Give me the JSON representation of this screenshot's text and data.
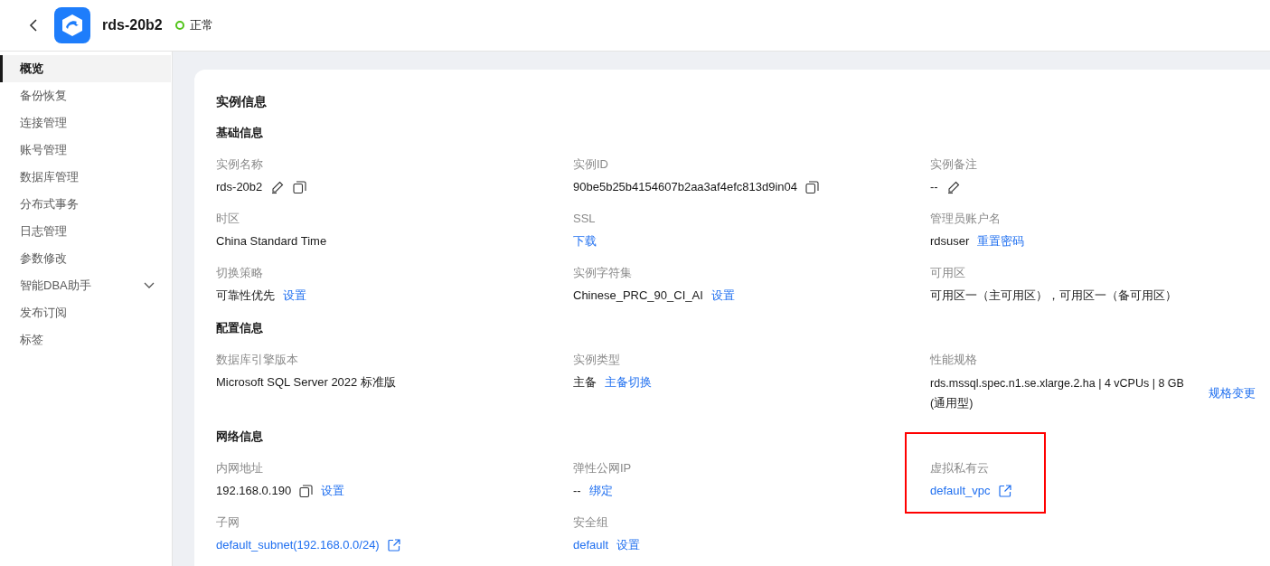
{
  "header": {
    "title": "rds-20b2",
    "status": {
      "label": "正常",
      "color": "#52c41a"
    }
  },
  "sidebar": {
    "items": [
      {
        "label": "概览",
        "selected": true
      },
      {
        "label": "备份恢复",
        "selected": false
      },
      {
        "label": "连接管理",
        "selected": false
      },
      {
        "label": "账号管理",
        "selected": false
      },
      {
        "label": "数据库管理",
        "selected": false
      },
      {
        "label": "分布式事务",
        "selected": false
      },
      {
        "label": "日志管理",
        "selected": false
      },
      {
        "label": "参数修改",
        "selected": false
      },
      {
        "label": "智能DBA助手",
        "selected": false,
        "expanded": false
      },
      {
        "label": "发布订阅",
        "selected": false
      },
      {
        "label": "标签",
        "selected": false
      }
    ]
  },
  "card": {
    "title": "实例信息",
    "sections": [
      {
        "title": "基础信息",
        "fields": [
          {
            "label": "实例名称",
            "parts": [
              {
                "kind": "text",
                "text": "rds-20b2"
              },
              {
                "kind": "edit"
              },
              {
                "kind": "copy"
              }
            ]
          },
          {
            "label": "实例ID",
            "parts": [
              {
                "kind": "text",
                "text": "90be5b25b4154607b2aa3af4efc813d9in04"
              },
              {
                "kind": "copy"
              }
            ]
          },
          {
            "label": "实例备注",
            "parts": [
              {
                "kind": "text",
                "text": "--"
              },
              {
                "kind": "edit"
              }
            ]
          },
          {
            "label": "时区",
            "parts": [
              {
                "kind": "text",
                "text": "China Standard Time"
              }
            ]
          },
          {
            "label": "SSL",
            "parts": [
              {
                "kind": "link",
                "text": "下载"
              }
            ]
          },
          {
            "label": "管理员账户名",
            "parts": [
              {
                "kind": "text",
                "text": "rdsuser"
              },
              {
                "kind": "link",
                "text": "重置密码"
              }
            ]
          },
          {
            "label": "切换策略",
            "parts": [
              {
                "kind": "text",
                "text": "可靠性优先"
              },
              {
                "kind": "link",
                "text": "设置"
              }
            ]
          },
          {
            "label": "实例字符集",
            "parts": [
              {
                "kind": "text",
                "text": "Chinese_PRC_90_CI_AI"
              },
              {
                "kind": "link",
                "text": "设置"
              }
            ]
          },
          {
            "label": "可用区",
            "parts": [
              {
                "kind": "text",
                "text": "可用区一（主可用区），可用区一（备可用区）"
              }
            ]
          }
        ]
      },
      {
        "title": "配置信息",
        "fields": [
          {
            "label": "数据库引擎版本",
            "parts": [
              {
                "kind": "text",
                "text": "Microsoft SQL Server 2022 标准版"
              }
            ]
          },
          {
            "label": "实例类型",
            "parts": [
              {
                "kind": "text",
                "text": "主备"
              },
              {
                "kind": "link",
                "text": "主备切换"
              }
            ]
          },
          {
            "label": "性能规格",
            "parts": [
              {
                "kind": "wrap",
                "text": "rds.mssql.spec.n1.se.xlarge.2.ha | 4 vCPUs | 8 GB (通用型)"
              },
              {
                "kind": "link",
                "text": "规格变更"
              }
            ]
          }
        ]
      },
      {
        "title": "网络信息",
        "fields": [
          {
            "label": "内网地址",
            "parts": [
              {
                "kind": "text",
                "text": "192.168.0.190"
              },
              {
                "kind": "copy"
              },
              {
                "kind": "link",
                "text": "设置"
              }
            ]
          },
          {
            "label": "弹性公网IP",
            "parts": [
              {
                "kind": "text",
                "text": "--"
              },
              {
                "kind": "link",
                "text": "绑定"
              }
            ]
          },
          {
            "label": "虚拟私有云",
            "highlighted": true,
            "parts": [
              {
                "kind": "link",
                "text": "default_vpc"
              },
              {
                "kind": "external"
              }
            ]
          },
          {
            "label": "子网",
            "parts": [
              {
                "kind": "link",
                "text": "default_subnet(192.168.0.0/24)"
              },
              {
                "kind": "external"
              }
            ]
          },
          {
            "label": "安全组",
            "parts": [
              {
                "kind": "link",
                "text": "default"
              },
              {
                "kind": "link",
                "text": "设置"
              }
            ]
          }
        ]
      }
    ]
  }
}
